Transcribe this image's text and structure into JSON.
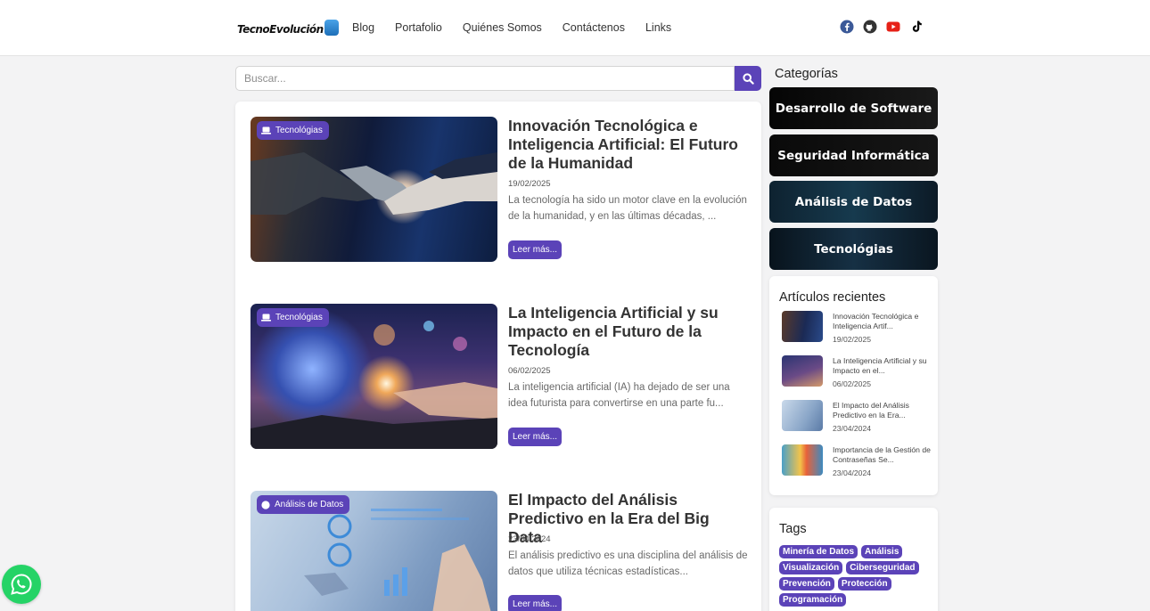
{
  "brand": {
    "logo_text": "TecnoEvolución"
  },
  "nav": {
    "items": [
      {
        "label": "Blog"
      },
      {
        "label": "Portafolio"
      },
      {
        "label": "Quiénes Somos"
      },
      {
        "label": "Contáctenos"
      },
      {
        "label": "Links"
      }
    ]
  },
  "social": [
    {
      "icon": "facebook-icon",
      "color": "#3b5998"
    },
    {
      "icon": "github-icon",
      "color": "#333333"
    },
    {
      "icon": "youtube-icon",
      "color": "#e62117"
    },
    {
      "icon": "tiktok-icon",
      "color": "#000000"
    }
  ],
  "search": {
    "placeholder": "Buscar..."
  },
  "posts": [
    {
      "category": "Tecnológias",
      "category_icon": "laptop-icon",
      "title": "Innovación Tecnológica e Inteligencia Artificial: El Futuro de la Humanidad",
      "date": "19/02/2025",
      "excerpt": "La tecnología ha sido un motor clave en la evolución de la humanidad, y en las últimas décadas, ...",
      "read_more": "Leer más..."
    },
    {
      "category": "Tecnológias",
      "category_icon": "laptop-icon",
      "title": "La Inteligencia Artificial y su Impacto en el Futuro de la Tecnología",
      "date": "06/02/2025",
      "excerpt": "La inteligencia artificial (IA) ha dejado de ser una idea futurista para convertirse en una parte fu...",
      "read_more": "Leer más..."
    },
    {
      "category": "Análisis de Datos",
      "category_icon": "database-icon",
      "title": "El Impacto del Análisis Predictivo en la Era del Big Data",
      "date": "23/04/2024",
      "excerpt": "El análisis predictivo es una disciplina del análisis de datos que utiliza técnicas estadísticas...",
      "read_more": "Leer más..."
    }
  ],
  "sidebar": {
    "categories_title": "Categorías",
    "categories": [
      {
        "label": "Desarrollo de Software"
      },
      {
        "label": "Seguridad Informática"
      },
      {
        "label": "Análisis de Datos"
      },
      {
        "label": "Tecnológias"
      }
    ],
    "recent_title": "Artículos recientes",
    "recent": [
      {
        "title": "Innovación Tecnológica e Inteligencia Artif...",
        "date": "19/02/2025"
      },
      {
        "title": "La Inteligencia Artificial y su Impacto en el...",
        "date": "06/02/2025"
      },
      {
        "title": "El Impacto del Análisis Predictivo en la Era...",
        "date": "23/04/2024"
      },
      {
        "title": "Importancia de la Gestión de Contraseñas Se...",
        "date": "23/04/2024"
      }
    ],
    "tags_title": "Tags",
    "tags": [
      "Minería de Datos",
      "Análisis",
      "Visualización",
      "Ciberseguridad",
      "Prevención",
      "Protección",
      "Programación"
    ]
  },
  "colors": {
    "accent": "#5b43b8",
    "whatsapp": "#25d366"
  }
}
